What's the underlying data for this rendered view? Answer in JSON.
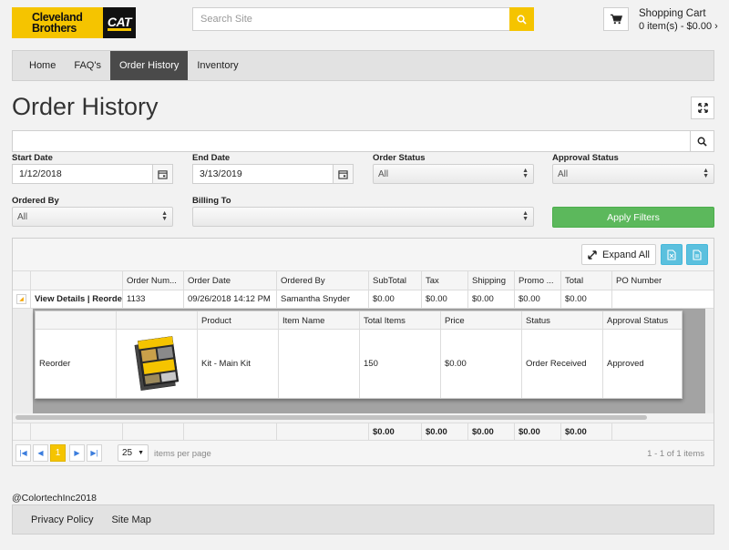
{
  "brand": {
    "line1": "Cleveland",
    "line2": "Brothers",
    "cat": "CAT",
    "accent": "#f5c400"
  },
  "search": {
    "placeholder": "Search Site"
  },
  "cart": {
    "title": "Shopping Cart",
    "summary": "0 item(s) - $0.00 ›"
  },
  "nav": [
    "Home",
    "FAQ's",
    "Order History",
    "Inventory"
  ],
  "page": {
    "title": "Order History"
  },
  "filters": {
    "start_date_label": "Start Date",
    "start_date": "1/12/2018",
    "end_date_label": "End Date",
    "end_date": "3/13/2019",
    "order_status_label": "Order Status",
    "order_status": "All",
    "approval_status_label": "Approval Status",
    "approval_status": "All",
    "ordered_by_label": "Ordered By",
    "ordered_by": "All",
    "billing_to_label": "Billing To",
    "billing_to": "",
    "apply_label": "Apply Filters"
  },
  "grid": {
    "expand_all_label": "Expand All",
    "columns": [
      "",
      "Order Num...",
      "Order Date",
      "Ordered By",
      "SubTotal",
      "Tax",
      "Shipping",
      "Promo ...",
      "Total",
      "PO Number"
    ],
    "rows": [
      [
        "View Details | Reorder",
        "1133",
        "09/26/2018 14:12 PM",
        "Samantha Snyder",
        "$0.00",
        "$0.00",
        "$0.00",
        "$0.00",
        "$0.00",
        ""
      ]
    ],
    "detail_columns": [
      "",
      "",
      "Product",
      "Item Name",
      "Total Items",
      "Price",
      "Status",
      "Approval Status"
    ],
    "detail_rows": [
      [
        "Reorder",
        "",
        "Kit - Main Kit",
        "",
        "150",
        "$0.00",
        "Order Received",
        "Approved"
      ]
    ],
    "totals": [
      "",
      "",
      "",
      "",
      "$0.00",
      "$0.00",
      "$0.00",
      "$0.00",
      "$0.00",
      ""
    ],
    "pager": {
      "current_page": "1",
      "page_size": "25",
      "items_per_page_label": "items per page",
      "info": "1 - 1 of 1 items"
    }
  },
  "footer": {
    "copyright": "@ColortechInc2018",
    "links": [
      "Privacy Policy",
      "Site Map"
    ]
  }
}
